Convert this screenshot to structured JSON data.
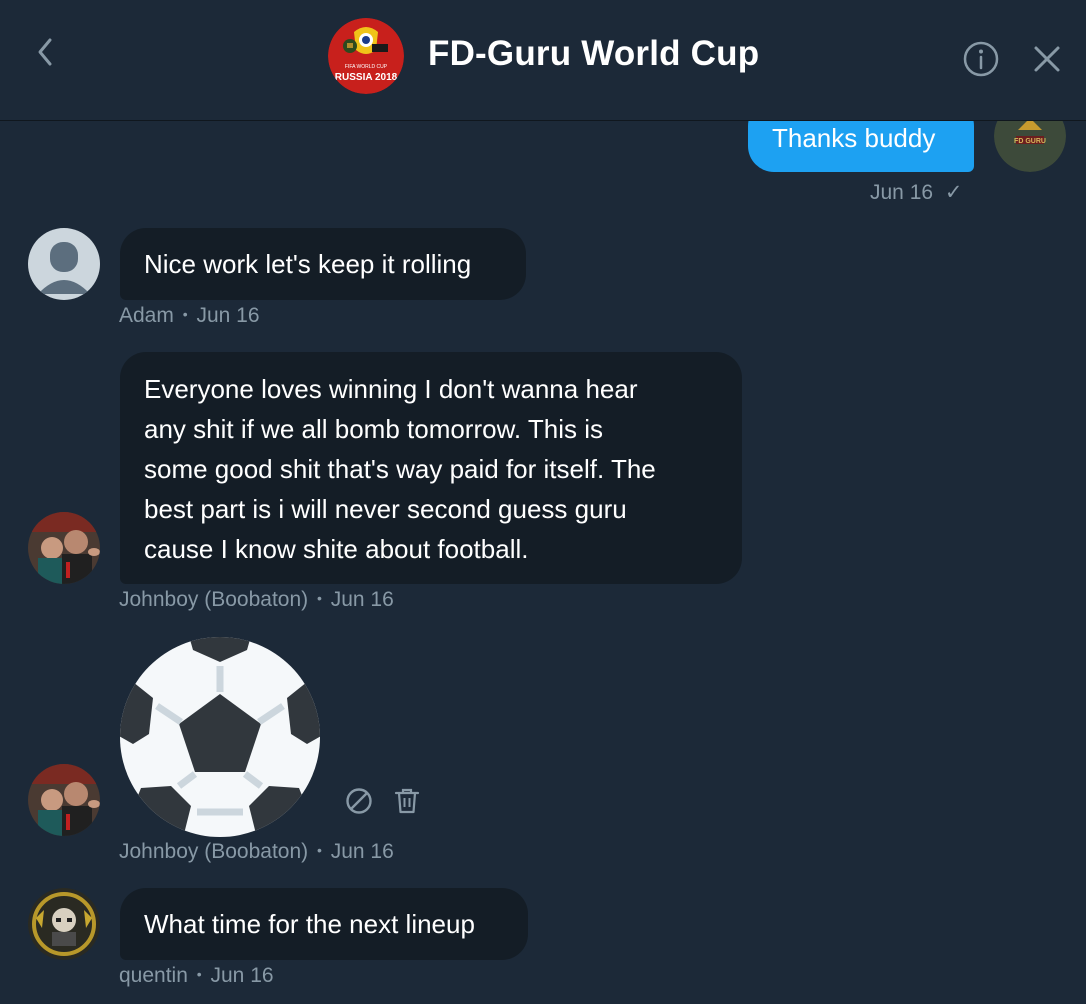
{
  "header": {
    "title": "FD-Guru World Cup",
    "avatar_text_top": "FIFA WORLD CUP",
    "avatar_text_bottom": "RUSSIA 2018"
  },
  "messages": {
    "m1": {
      "text": "Thanks buddy",
      "time": "Jun 16",
      "status": "✓",
      "avatar_label": "FD GURU"
    },
    "m2": {
      "text": "Nice work let's keep it rolling",
      "sender": "Adam",
      "time": "Jun 16"
    },
    "m3": {
      "lines": [
        "Everyone loves winning I don't wanna hear",
        "any shit if we all bomb tomorrow. This is",
        "some good shit that's way paid for itself. The",
        "best part is i will never second guess guru",
        "cause I know shite about football."
      ],
      "sender": "Johnboy (Boobaton)",
      "time": "Jun 16"
    },
    "m4": {
      "sender": "Johnboy (Boobaton)",
      "time": "Jun 16"
    },
    "m5": {
      "text": "What time for the next lineup",
      "sender": "quentin",
      "time": "Jun 16"
    }
  },
  "separator": "•",
  "colors": {
    "background": "#1c2938",
    "incoming_bubble": "#141d26",
    "outgoing_bubble": "#1da1f2",
    "meta_text": "#8899a6"
  }
}
